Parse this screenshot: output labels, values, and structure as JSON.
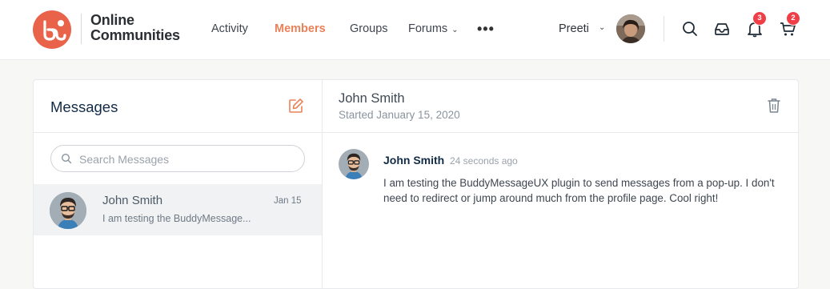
{
  "brand": {
    "name_line1": "Online",
    "name_line2": "Communities",
    "accent": "#e8634a"
  },
  "nav": {
    "items": [
      {
        "label": "Activity",
        "active": false
      },
      {
        "label": "Members",
        "active": true
      },
      {
        "label": "Groups",
        "active": false
      },
      {
        "label": "Forums",
        "active": false,
        "dropdown": true
      }
    ],
    "more": "•••"
  },
  "user": {
    "name": "Preeti",
    "chevron": "⌄"
  },
  "icons": {
    "search": "search-icon",
    "inbox": "inbox-icon",
    "notifications": "bell-icon",
    "cart": "cart-icon"
  },
  "badges": {
    "notifications": "3",
    "cart": "2",
    "color": "#ef3e46"
  },
  "messages_panel": {
    "title": "Messages",
    "search_placeholder": "Search Messages",
    "threads": [
      {
        "name": "John Smith",
        "date": "Jan 15",
        "preview": "I am testing the BuddyMessage..."
      }
    ]
  },
  "conversation": {
    "name": "John Smith",
    "started": "Started January 15, 2020",
    "messages": [
      {
        "author": "John Smith",
        "time": "24 seconds ago",
        "body": "I am testing the BuddyMessageUX plugin to send messages from a pop-up. I don't need to redirect or jump around much from the profile page. Cool right!"
      }
    ]
  }
}
